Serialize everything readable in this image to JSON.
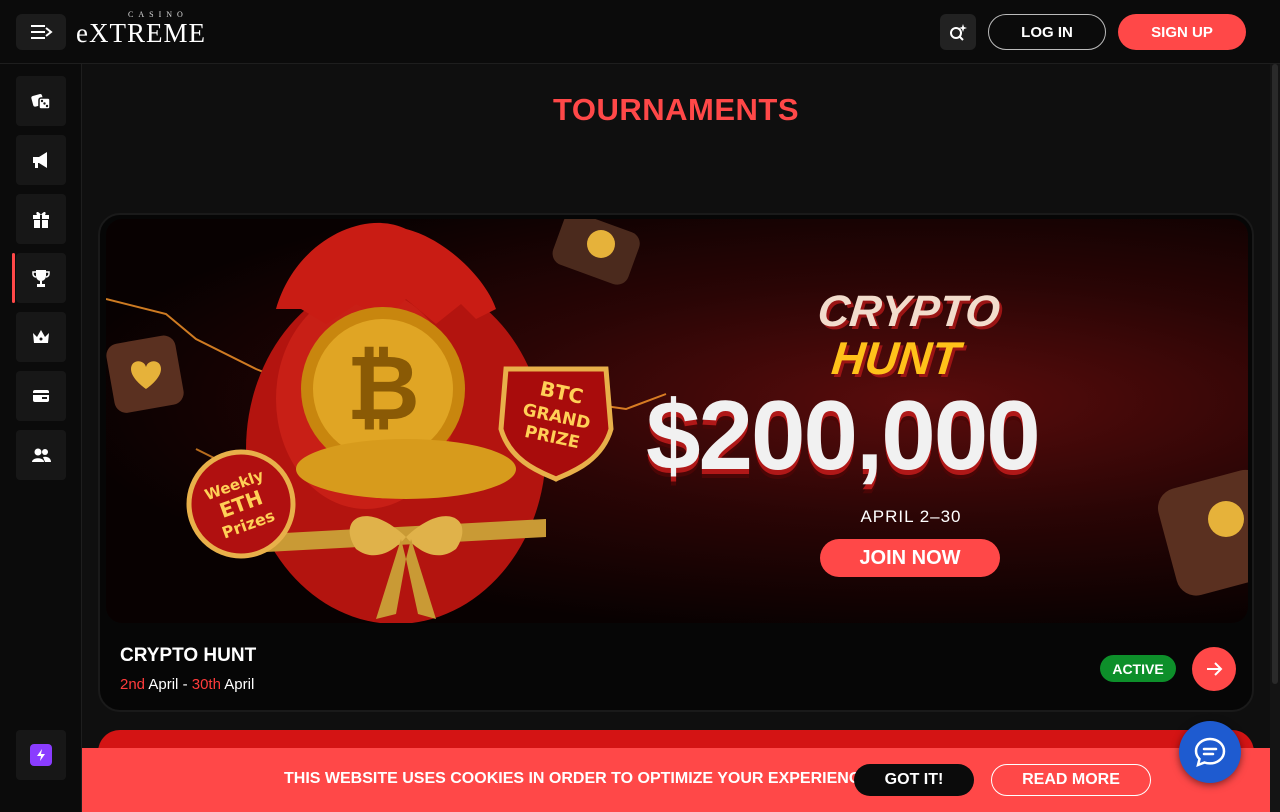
{
  "header": {
    "menu_icon": "menu-icon",
    "logo_small": "CASINO",
    "logo_big": "eXTREME",
    "search_icon": "search-sparkle-icon",
    "login_label": "LOG IN",
    "signup_label": "SIGN UP"
  },
  "sidebar": {
    "items": [
      {
        "icon": "dice-icon"
      },
      {
        "icon": "megaphone-icon"
      },
      {
        "icon": "gift-icon"
      },
      {
        "icon": "trophy-icon",
        "active": true
      },
      {
        "icon": "crown-icon"
      },
      {
        "icon": "wallet-icon"
      },
      {
        "icon": "users-icon"
      }
    ],
    "bottom_icon": "lightning-icon"
  },
  "page": {
    "title": "TOURNAMENTS"
  },
  "tournament": {
    "banner": {
      "title_line1": "CRYPTO",
      "title_line2": "HUNT",
      "amount": "$200,000",
      "dates": "APRIL 2–30",
      "join_label": "JOIN NOW",
      "badge_left": "Weekly ETH Prizes",
      "badge_right": "BTC GRAND PRIZE"
    },
    "name": "CRYPTO HUNT",
    "start_day": "2nd",
    "start_month": "April",
    "separator": "-",
    "end_day": "30th",
    "end_month": "April",
    "status": "ACTIVE"
  },
  "cookie": {
    "message": "THIS WEBSITE USES COOKIES IN ORDER TO OPTIMIZE YOUR EXPERIENCE.",
    "accept_label": "GOT IT!",
    "more_label": "READ MORE"
  },
  "colors": {
    "accent": "#ff4848",
    "active_green": "#0d8f2a",
    "chat_blue": "#1e5bd0",
    "bolt_purple": "#8a3cff"
  }
}
